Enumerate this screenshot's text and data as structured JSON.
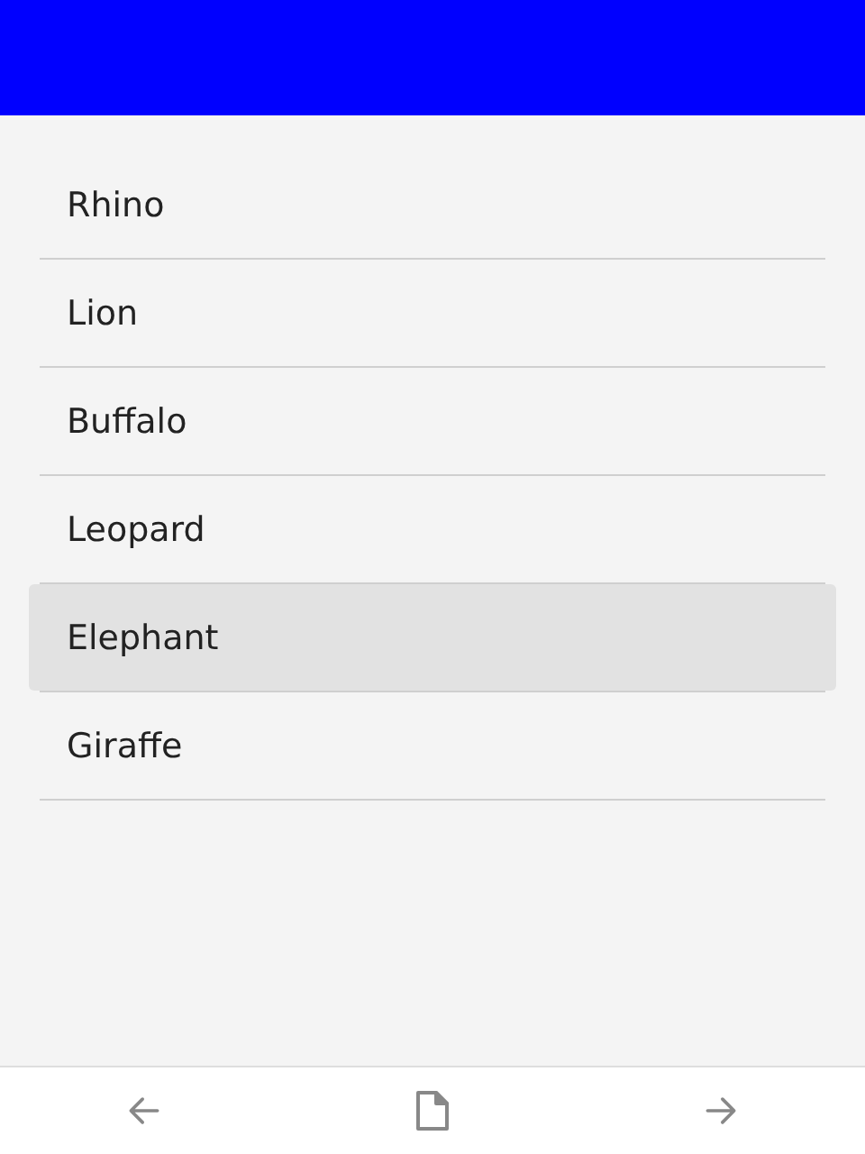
{
  "list": {
    "items": [
      {
        "label": "Rhino",
        "selected": false
      },
      {
        "label": "Lion",
        "selected": false
      },
      {
        "label": "Buffalo",
        "selected": false
      },
      {
        "label": "Leopard",
        "selected": false
      },
      {
        "label": "Elephant",
        "selected": true
      },
      {
        "label": "Giraffe",
        "selected": false
      }
    ]
  }
}
